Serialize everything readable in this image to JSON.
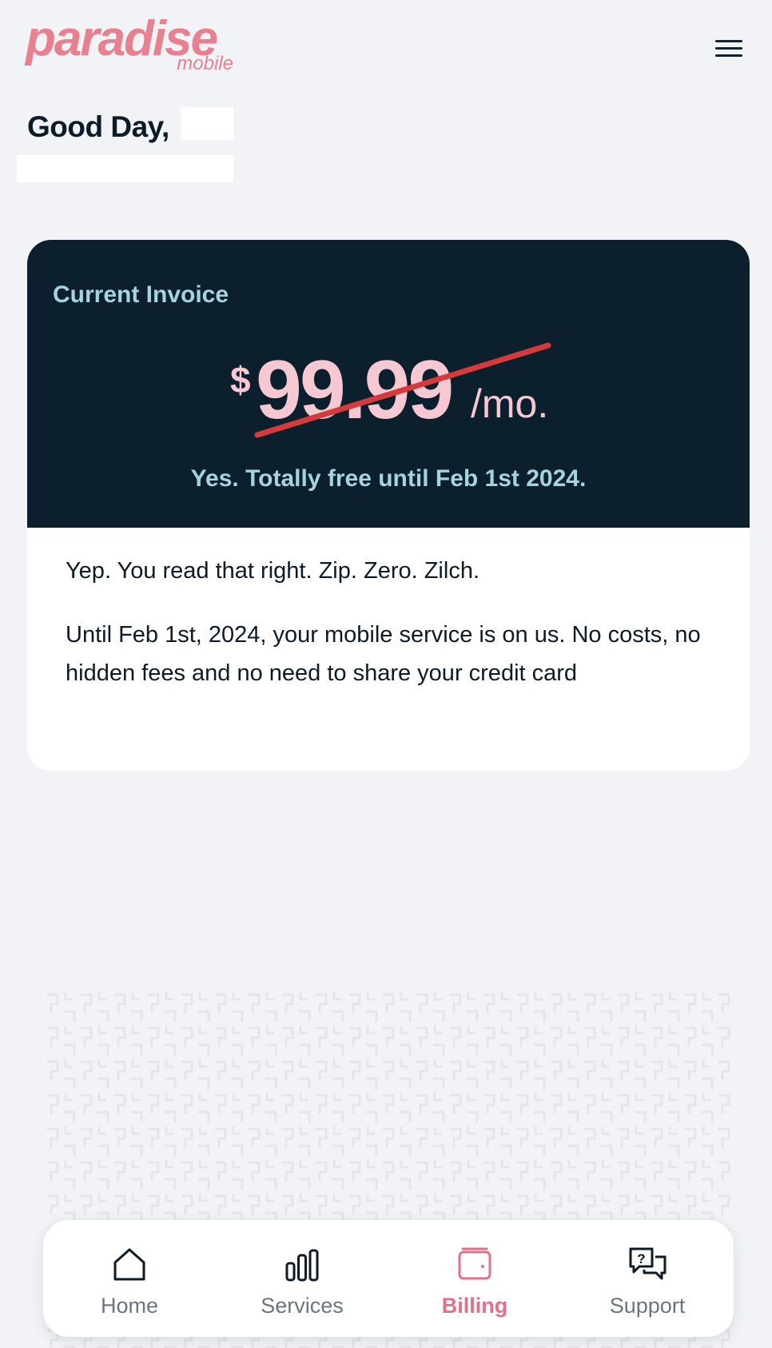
{
  "header": {
    "logo_main": "paradise",
    "logo_sub": "mobile",
    "greeting": "Good Day,"
  },
  "invoice": {
    "label": "Current Invoice",
    "currency": "$",
    "amount": "99.99",
    "unit": "/mo.",
    "free_note": "Yes. Totally free until Feb 1st 2024.",
    "paragraph_1": "Yep. You read that right. Zip. Zero. Zilch.",
    "paragraph_2": "Until Feb 1st, 2024, your mobile service is on us. No costs, no hidden fees and no need to share your credit card"
  },
  "nav": {
    "items": [
      {
        "label": "Home",
        "icon": "home-icon",
        "active": false
      },
      {
        "label": "Services",
        "icon": "bar-chart-icon",
        "active": false
      },
      {
        "label": "Billing",
        "icon": "wallet-icon",
        "active": true
      },
      {
        "label": "Support",
        "icon": "chat-help-icon",
        "active": false
      }
    ]
  },
  "colors": {
    "brand": "#e8808f",
    "card_dark": "#0b1f2c",
    "accent_text": "#a6d3e0",
    "price": "#f6c9d2",
    "strike": "#d53b3b",
    "nav_active": "#e2708a",
    "nav_inactive": "#6b7580"
  }
}
